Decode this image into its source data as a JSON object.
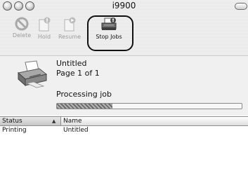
{
  "window": {
    "title": "i9900"
  },
  "toolbar": {
    "delete_label": "Delete",
    "hold_label": "Hold",
    "resume_label": "Resume",
    "stop_jobs_label": "Stop Jobs"
  },
  "job": {
    "name": "Untitled",
    "page_status": "Page 1 of 1",
    "status_text": "Processing job",
    "progress": 0.3
  },
  "table": {
    "columns": [
      "Status",
      "Name"
    ],
    "rows": [
      {
        "status": "Printing",
        "name": "Untitled"
      }
    ]
  }
}
